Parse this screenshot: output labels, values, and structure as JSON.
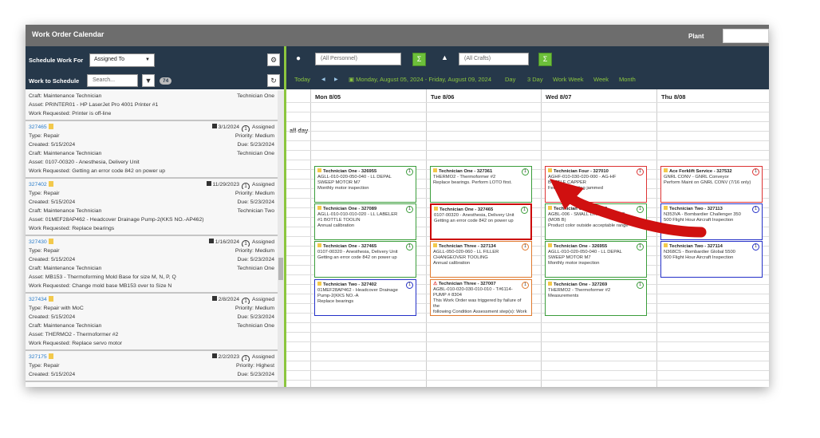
{
  "window": {
    "title": "Work Order Calendar",
    "plant_label": "Plant"
  },
  "left": {
    "schedule_for_label": "Schedule Work For",
    "schedule_for_value": "Assigned To",
    "work_to_schedule_label": "Work to Schedule",
    "search_placeholder": "Search...",
    "count": "74",
    "items": [
      {
        "partial": true,
        "lines": [
          [
            "Craft: Maintenance Technician",
            "Technician One"
          ],
          [
            "Asset: PRINTER01 - HP LaserJet Pro 4001 Printer #1",
            ""
          ],
          [
            "Work Requested: Printer is off-line",
            ""
          ]
        ]
      },
      {
        "wo": "327465",
        "date": "3/1/2024",
        "count": "1",
        "status": "Assigned",
        "lines": [
          [
            "Type: Repair",
            "Priority: Medium"
          ],
          [
            "Created: 5/15/2024",
            "Due: 5/23/2024"
          ],
          [
            "Craft: Maintenance Technician",
            "Technician One"
          ],
          [
            "Asset: 0107-00320 - Anesthesia, Delivery Unit",
            ""
          ],
          [
            "Work Requested: Getting an error code 842 on power up",
            ""
          ]
        ]
      },
      {
        "wo": "327402",
        "date": "11/29/2023",
        "count": "1",
        "status": "Assigned",
        "lines": [
          [
            "Type: Repair",
            "Priority: Medium"
          ],
          [
            "Created: 5/15/2024",
            "Due: 5/23/2024"
          ],
          [
            "Craft: Maintenance Technician",
            "Technician Two"
          ],
          [
            "Asset: 01MEF28AP462 - Headcover Drainage Pump-2(KKS NO.-AP462)",
            ""
          ],
          [
            "Work Requested: Replace bearings",
            ""
          ]
        ]
      },
      {
        "wo": "327430",
        "date": "1/16/2024",
        "count": "1",
        "status": "Assigned",
        "lines": [
          [
            "Type: Repair",
            "Priority: Medium"
          ],
          [
            "Created: 5/15/2024",
            "Due: 5/23/2024"
          ],
          [
            "Craft: Maintenance Technician",
            "Technician One"
          ],
          [
            "Asset: MB153 - Thermoforming Mold Base for size M, N, P, Q",
            ""
          ],
          [
            "Work Requested: Change mold base MB153 over to Size N",
            ""
          ]
        ]
      },
      {
        "wo": "327434",
        "date": "2/8/2024",
        "count": "1",
        "status": "Assigned",
        "lines": [
          [
            "Type: Repair with MoC",
            "Priority: Medium"
          ],
          [
            "Created: 5/15/2024",
            "Due: 5/23/2024"
          ],
          [
            "Craft: Maintenance Technician",
            "Technician One"
          ],
          [
            "Asset: THERMO2 - Thermoformer #2",
            ""
          ],
          [
            "Work Requested: Replace servo motor",
            ""
          ]
        ]
      },
      {
        "wo": "327175",
        "date": "2/2/2023",
        "count": "1",
        "status": "Assigned",
        "lines": [
          [
            "Type: Repair",
            "Priority: Highest"
          ],
          [
            "Created: 5/15/2024",
            "Due: 5/23/2024"
          ]
        ]
      }
    ]
  },
  "right": {
    "personnel_placeholder": "(All Personnel)",
    "crafts_placeholder": "(All Crafts)",
    "today": "Today",
    "prev": "◀",
    "next": "▶",
    "range": "Monday, August 05, 2024 - Friday, August 09, 2024",
    "views": [
      "Day",
      "3 Day",
      "Work Week",
      "Week",
      "Month"
    ],
    "all_day": "all day",
    "days": [
      "Mon 8/05",
      "Tue 8/06",
      "Wed 8/07",
      "Thu 8/08"
    ],
    "cards": [
      {
        "d": 0,
        "r": 0,
        "c": "green",
        "h": "Technician One - 326955",
        "b": [
          "AGLL-010-020-050-040 - LL DEPAL",
          "SWEEP MOTOR M7",
          "Monthly motor inspection"
        ],
        "n": "1"
      },
      {
        "d": 0,
        "r": 1,
        "c": "green",
        "h": "Technician One - 327089",
        "b": [
          "AGLL-010-010-010-020 - LL LABELER",
          "#1 BOTTLE TOOLIN",
          "Annual calibration"
        ],
        "n": "1"
      },
      {
        "d": 0,
        "r": 2,
        "c": "green",
        "h": "Technician One - 327465",
        "b": [
          "0107-00320 - Anesthesia, Delivery Unit",
          "Getting an error code 842 on power up"
        ],
        "n": "1"
      },
      {
        "d": 0,
        "r": 3,
        "c": "blue",
        "h": "Technician Two - 327402",
        "b": [
          "01MEF28AP462 - Headcover Drainage",
          "Pump-2(KKS NO.-A",
          "Replace bearings"
        ],
        "n": "1"
      },
      {
        "d": 1,
        "r": 0,
        "c": "green",
        "h": "Technician One - 327361",
        "b": [
          "THERMO2 - Thermoformer #2",
          "Replace bearings. Perform LOTO first."
        ],
        "n": "1"
      },
      {
        "d": 1,
        "r": 1,
        "c": "sel2",
        "h": "Technician One - 327465",
        "b": [
          "0107-00320 - Anesthesia, Delivery Unit",
          "Getting an error code 842 on power up"
        ],
        "n": "1"
      },
      {
        "d": 1,
        "r": 2,
        "c": "orange",
        "h": "Technician Three - 327134",
        "b": [
          "AGLL-050-020-060 - LL FILLER",
          "CHANGEOVER TOOLING",
          "Annual calibration"
        ],
        "n": "1"
      },
      {
        "d": 1,
        "r": 3,
        "c": "orange",
        "h": "Technician Three - 327007",
        "b": [
          "AGBL-010-020-030-010-010 - T#6114-",
          "PUMP # 8304",
          "This Work Order was triggered by failure of the",
          "following Condition Assessment step(s): Work",
          "Order #"
        ],
        "n": "1",
        "warn": true
      },
      {
        "d": 2,
        "r": 0,
        "c": "red",
        "h": "Technician Four - 327010",
        "b": [
          "AGHF-010-030-020-000 - AG-HF",
          "BOTTLE CAPPER",
          "Feed roller getting jammed"
        ],
        "n": "1"
      },
      {
        "d": 2,
        "r": 1,
        "c": "green",
        "h": "Technician One - 326982",
        "b": [
          "AGBL-006 - SMALL LINE BLENDING",
          "(MOB B)",
          "Product color outside acceptable range"
        ],
        "n": "1"
      },
      {
        "d": 2,
        "r": 2,
        "c": "green",
        "h": "Technician One - 326955",
        "b": [
          "AGLL-010-020-050-040 - LL DEPAL",
          "SWEEP MOTOR M7",
          "Monthly motor inspection"
        ],
        "n": "1"
      },
      {
        "d": 2,
        "r": 3,
        "c": "green",
        "h": "Technician One - 327269",
        "b": [
          "THERMO2 - Thermoformer #2",
          "Measurements"
        ],
        "n": "1"
      },
      {
        "d": 3,
        "r": 0,
        "c": "red",
        "h": "Ace Forklift Service - 327532",
        "b": [
          "GNRL CONV - GNRL Conveyor",
          "Perform Maint on GNRL CONV (7/16 only)"
        ],
        "n": "1"
      },
      {
        "d": 3,
        "r": 1,
        "c": "blue",
        "h": "Technician Two - 327113",
        "b": [
          "N353VA - Bombardier Challenger 350",
          "500 Flight Hour Aircraft Inspection"
        ],
        "n": "1"
      },
      {
        "d": 3,
        "r": 2,
        "c": "blue",
        "h": "Technician Two - 327114",
        "b": [
          "N368CS - Bombardier Global 5500",
          "500 Flight Hour Aircraft Inspection"
        ],
        "n": "1"
      }
    ],
    "colors": {
      "green": "#3a9d3a",
      "red": "#d33",
      "blue": "#2430c8",
      "orange": "#e07a2e",
      "accent": "#8cc63f",
      "header": "#26384a"
    }
  }
}
